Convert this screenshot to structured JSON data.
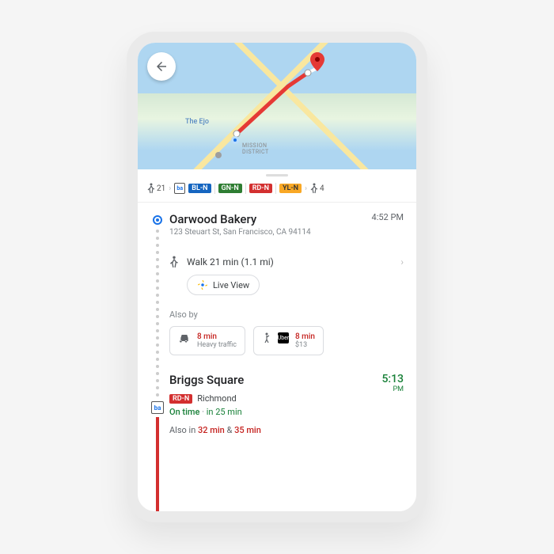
{
  "map": {
    "poi_label": "The Ejo",
    "district": "MISSION\nDISTRICT"
  },
  "summary": {
    "walk_start": "21",
    "lines": [
      "BL-N",
      "GN-N",
      "RD-N",
      "YL-N"
    ],
    "walk_end": "4"
  },
  "origin": {
    "name": "Oarwood Bakery",
    "address": "123 Steuart St, San Francisco, CA 94114",
    "time": "4:52 PM"
  },
  "walk": {
    "text": "Walk 21 min (1.1 mi)",
    "live_view": "Live View"
  },
  "also_by": {
    "label": "Also by",
    "drive": {
      "time": "8 min",
      "sub": "Heavy traffic"
    },
    "rideshare": {
      "time": "8 min",
      "sub": "$13"
    }
  },
  "transit": {
    "station": "Briggs Square",
    "line_badge": "RD-N",
    "direction": "Richmond",
    "status": "On time",
    "in": "in 25 min",
    "depart_time": "5:13",
    "depart_ampm": "PM",
    "also_in_prefix": "Also in ",
    "also_in_1": "32 min",
    "also_in_amp": " & ",
    "also_in_2": "35 min"
  }
}
